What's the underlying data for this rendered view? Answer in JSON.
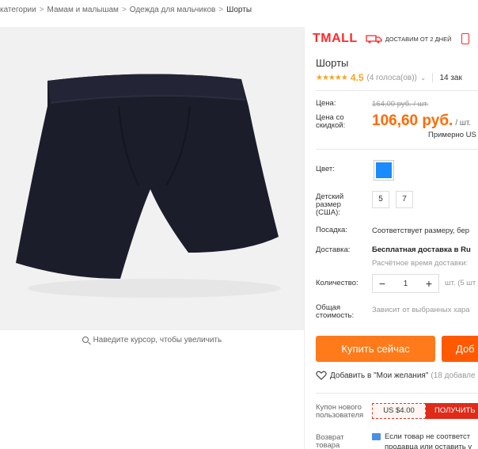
{
  "breadcrumb": {
    "items": [
      "категории",
      "Мамам и малышам",
      "Одежда для мальчиков",
      "Шорты"
    ],
    "separator": ">"
  },
  "gallery": {
    "zoom_hint": "Наведите курсор, чтобы увеличить",
    "zoom_icon": "magnifier-icon"
  },
  "header": {
    "brand": "TMALL",
    "delivery_icon": "truck-icon",
    "delivery_text": "ДОСТАВИМ ОТ 2 ДНЕЙ"
  },
  "product": {
    "title": "Шорты",
    "stars": "★★★★★",
    "rating": "4.5",
    "votes": "(4 голоса(ов))",
    "votes_chevron": "⌄",
    "orders": "14 зак"
  },
  "price": {
    "label": "Цена:",
    "old": "164,00 руб. / шт.",
    "discount_label": "Цена со скидкой:",
    "new": "106,60 руб.",
    "unit": "/ шт.",
    "approx": "Примерно US"
  },
  "options": {
    "color_label": "Цвет:",
    "selected_color": "#1a8cff",
    "size_label": "Детский размер (США):",
    "sizes": [
      "5",
      "7"
    ],
    "fit_label": "Посадка:",
    "fit_value": "Соответствует размеру, бер",
    "shipping_label": "Доставка:",
    "shipping_value": "Бесплатная доставка в Ru",
    "shipping_note": "Расчётное время доставки:",
    "quantity_label": "Количество:",
    "quantity_minus": "−",
    "quantity_value": "1",
    "quantity_plus": "+",
    "stock": "шт. (5 шт",
    "total_label": "Общая стоимость:",
    "total_value": "Зависит от выбранных хара"
  },
  "actions": {
    "buy": "Купить сейчас",
    "add_to_cart": "Доб",
    "wishlist_icon": "heart-icon",
    "wishlist": "Добавить в \"Мои желания\"",
    "wishlist_count": "(18 добавле"
  },
  "coupon": {
    "label": "Купон нового пользователя",
    "value": "US $4.00",
    "button": "ПОЛУЧИТЬ"
  },
  "returns": {
    "label": "Возврат товара",
    "icon": "document-icon",
    "line1": "Если товар не соответст",
    "line2": "продавца или оставить у"
  },
  "colors": {
    "accent_orange": "#ff7a1a",
    "price_orange": "#ff6a00",
    "tmall_red": "#ff2a2a",
    "star_gold": "#f5a623"
  }
}
